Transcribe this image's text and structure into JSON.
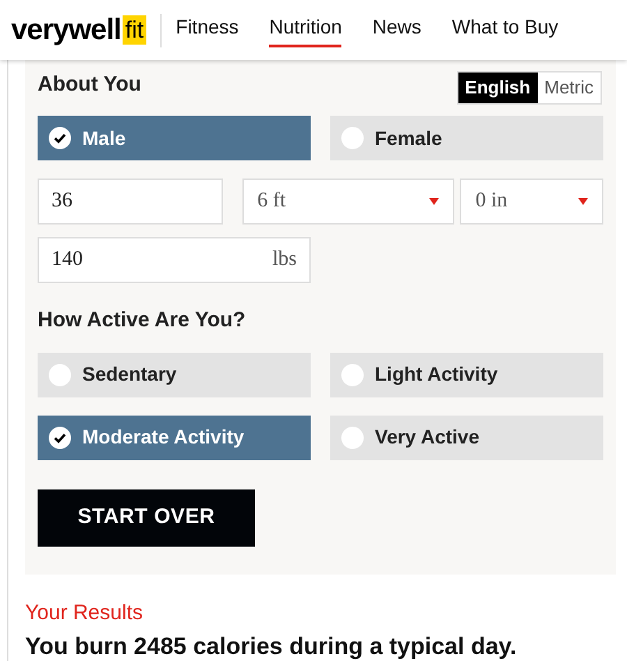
{
  "header": {
    "logo": {
      "word": "verywell",
      "badge": "fit"
    },
    "nav": [
      {
        "label": "Fitness",
        "selected": false
      },
      {
        "label": "Nutrition",
        "selected": true
      },
      {
        "label": "News",
        "selected": false
      },
      {
        "label": "What to Buy",
        "selected": false
      }
    ]
  },
  "form": {
    "title": "About You",
    "units": [
      {
        "label": "English",
        "selected": true
      },
      {
        "label": "Metric",
        "selected": false
      }
    ],
    "gender": [
      {
        "label": "Male",
        "selected": true
      },
      {
        "label": "Female",
        "selected": false
      }
    ],
    "age": {
      "value": "36"
    },
    "height_feet": {
      "value": "6 ft"
    },
    "height_inches": {
      "value": "0 in"
    },
    "weight": {
      "value": "140",
      "unit": "lbs"
    },
    "activity_title": "How Active Are You?",
    "activity": [
      {
        "label": "Sedentary",
        "selected": false
      },
      {
        "label": "Light Activity",
        "selected": false
      },
      {
        "label": "Moderate Activity",
        "selected": true
      },
      {
        "label": "Very Active",
        "selected": false
      }
    ],
    "button": "START OVER"
  },
  "results": {
    "title": "Your Results",
    "text": "You burn 2485 calories during a typical day."
  }
}
